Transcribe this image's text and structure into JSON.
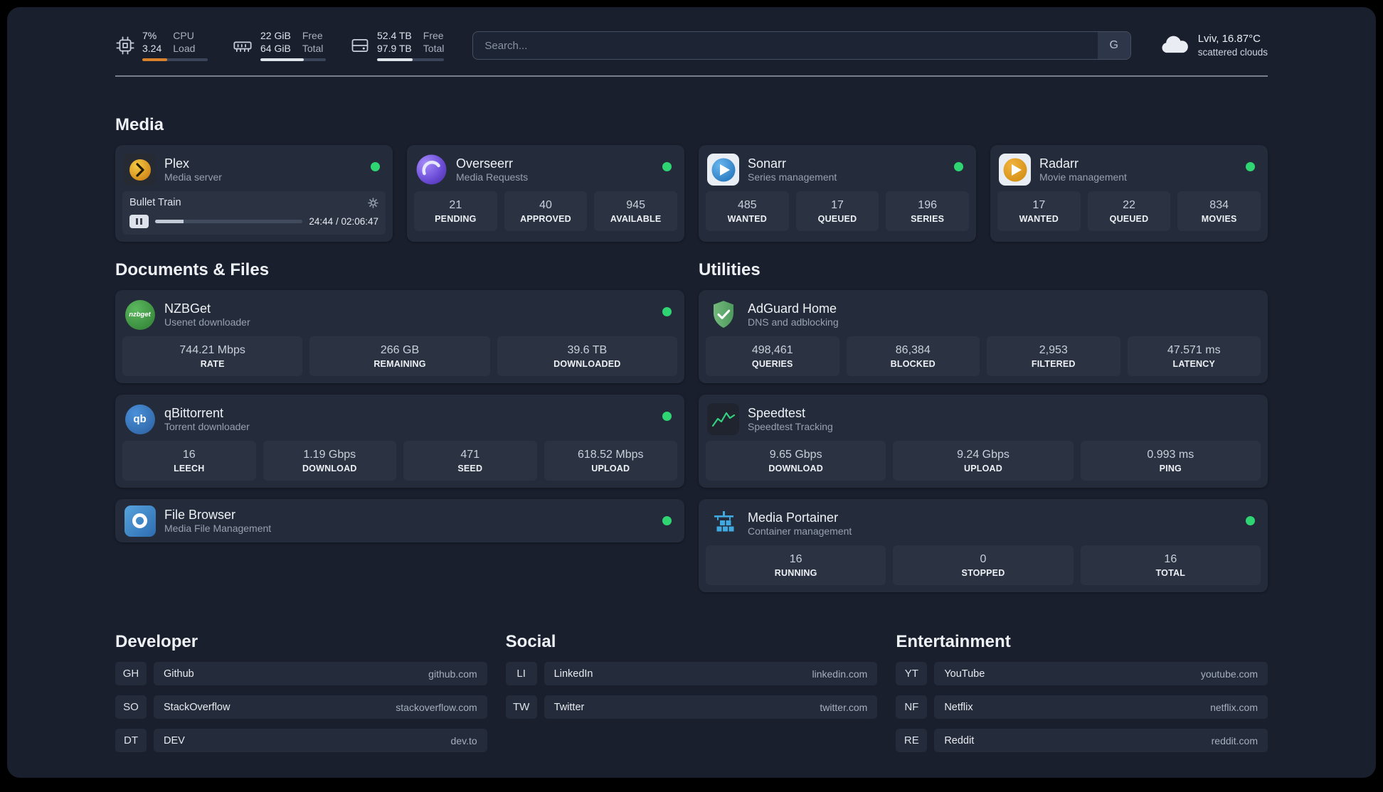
{
  "topbar": {
    "cpu": {
      "value_top": "7%",
      "value_bottom": "3.24",
      "label_top": "CPU",
      "label_bottom": "Load",
      "bar_width": "38%"
    },
    "memory": {
      "value_top": "22 GiB",
      "value_bottom": "64 GiB",
      "label_top": "Free",
      "label_bottom": "Total",
      "bar_width": "66%"
    },
    "disk": {
      "value_top": "52.4 TB",
      "value_bottom": "97.9 TB",
      "label_top": "Free",
      "label_bottom": "Total",
      "bar_width": "53%"
    },
    "search": {
      "placeholder": "Search...",
      "button_label": "G"
    },
    "weather": {
      "location": "Lviv, 16.87°C",
      "condition": "scattered clouds"
    }
  },
  "sections": {
    "media": "Media",
    "documents": "Documents & Files",
    "utilities": "Utilities",
    "developer": "Developer",
    "social": "Social",
    "entertainment": "Entertainment"
  },
  "services": {
    "plex": {
      "name": "Plex",
      "desc": "Media server",
      "status": "online",
      "player": {
        "title": "Bullet Train",
        "elapsed": "24:44 / 02:06:47",
        "progress_width": "19.5%"
      }
    },
    "overseerr": {
      "name": "Overseerr",
      "desc": "Media Requests",
      "status": "online",
      "stats": [
        {
          "value": "21",
          "label": "PENDING"
        },
        {
          "value": "40",
          "label": "APPROVED"
        },
        {
          "value": "945",
          "label": "AVAILABLE"
        }
      ]
    },
    "sonarr": {
      "name": "Sonarr",
      "desc": "Series management",
      "status": "online",
      "stats": [
        {
          "value": "485",
          "label": "WANTED"
        },
        {
          "value": "17",
          "label": "QUEUED"
        },
        {
          "value": "196",
          "label": "SERIES"
        }
      ]
    },
    "radarr": {
      "name": "Radarr",
      "desc": "Movie management",
      "status": "online",
      "stats": [
        {
          "value": "17",
          "label": "WANTED"
        },
        {
          "value": "22",
          "label": "QUEUED"
        },
        {
          "value": "834",
          "label": "MOVIES"
        }
      ]
    },
    "nzbget": {
      "name": "NZBGet",
      "desc": "Usenet downloader",
      "status": "online",
      "logo_text": "nzbget",
      "stats": [
        {
          "value": "744.21 Mbps",
          "label": "RATE"
        },
        {
          "value": "266 GB",
          "label": "REMAINING"
        },
        {
          "value": "39.6 TB",
          "label": "DOWNLOADED"
        }
      ]
    },
    "qbittorrent": {
      "name": "qBittorrent",
      "desc": "Torrent downloader",
      "status": "online",
      "logo_text": "qb",
      "stats": [
        {
          "value": "16",
          "label": "LEECH"
        },
        {
          "value": "1.19 Gbps",
          "label": "DOWNLOAD"
        },
        {
          "value": "471",
          "label": "SEED"
        },
        {
          "value": "618.52 Mbps",
          "label": "UPLOAD"
        }
      ]
    },
    "filebrowser": {
      "name": "File Browser",
      "desc": "Media File Management",
      "status": "online"
    },
    "adguard": {
      "name": "AdGuard Home",
      "desc": "DNS and adblocking",
      "status": "online",
      "stats": [
        {
          "value": "498,461",
          "label": "QUERIES"
        },
        {
          "value": "86,384",
          "label": "BLOCKED"
        },
        {
          "value": "2,953",
          "label": "FILTERED"
        },
        {
          "value": "47.571 ms",
          "label": "LATENCY"
        }
      ]
    },
    "speedtest": {
      "name": "Speedtest",
      "desc": "Speedtest Tracking",
      "status": "online",
      "stats": [
        {
          "value": "9.65 Gbps",
          "label": "DOWNLOAD"
        },
        {
          "value": "9.24 Gbps",
          "label": "UPLOAD"
        },
        {
          "value": "0.993 ms",
          "label": "PING"
        }
      ]
    },
    "portainer": {
      "name": "Media Portainer",
      "desc": "Container management",
      "status": "online",
      "stats": [
        {
          "value": "16",
          "label": "RUNNING"
        },
        {
          "value": "0",
          "label": "STOPPED"
        },
        {
          "value": "16",
          "label": "TOTAL"
        }
      ]
    }
  },
  "links": {
    "developer": [
      {
        "abbr": "GH",
        "name": "Github",
        "url": "github.com"
      },
      {
        "abbr": "SO",
        "name": "StackOverflow",
        "url": "stackoverflow.com"
      },
      {
        "abbr": "DT",
        "name": "DEV",
        "url": "dev.to"
      }
    ],
    "social": [
      {
        "abbr": "LI",
        "name": "LinkedIn",
        "url": "linkedin.com"
      },
      {
        "abbr": "TW",
        "name": "Twitter",
        "url": "twitter.com"
      }
    ],
    "entertainment": [
      {
        "abbr": "YT",
        "name": "YouTube",
        "url": "youtube.com"
      },
      {
        "abbr": "NF",
        "name": "Netflix",
        "url": "netflix.com"
      },
      {
        "abbr": "RE",
        "name": "Reddit",
        "url": "reddit.com"
      }
    ]
  },
  "colors": {
    "status_online": "#2fd573",
    "cpu_bar": "#d9822b",
    "background": "#191f2d",
    "card": "#242b3a",
    "tile": "#2b3343"
  }
}
